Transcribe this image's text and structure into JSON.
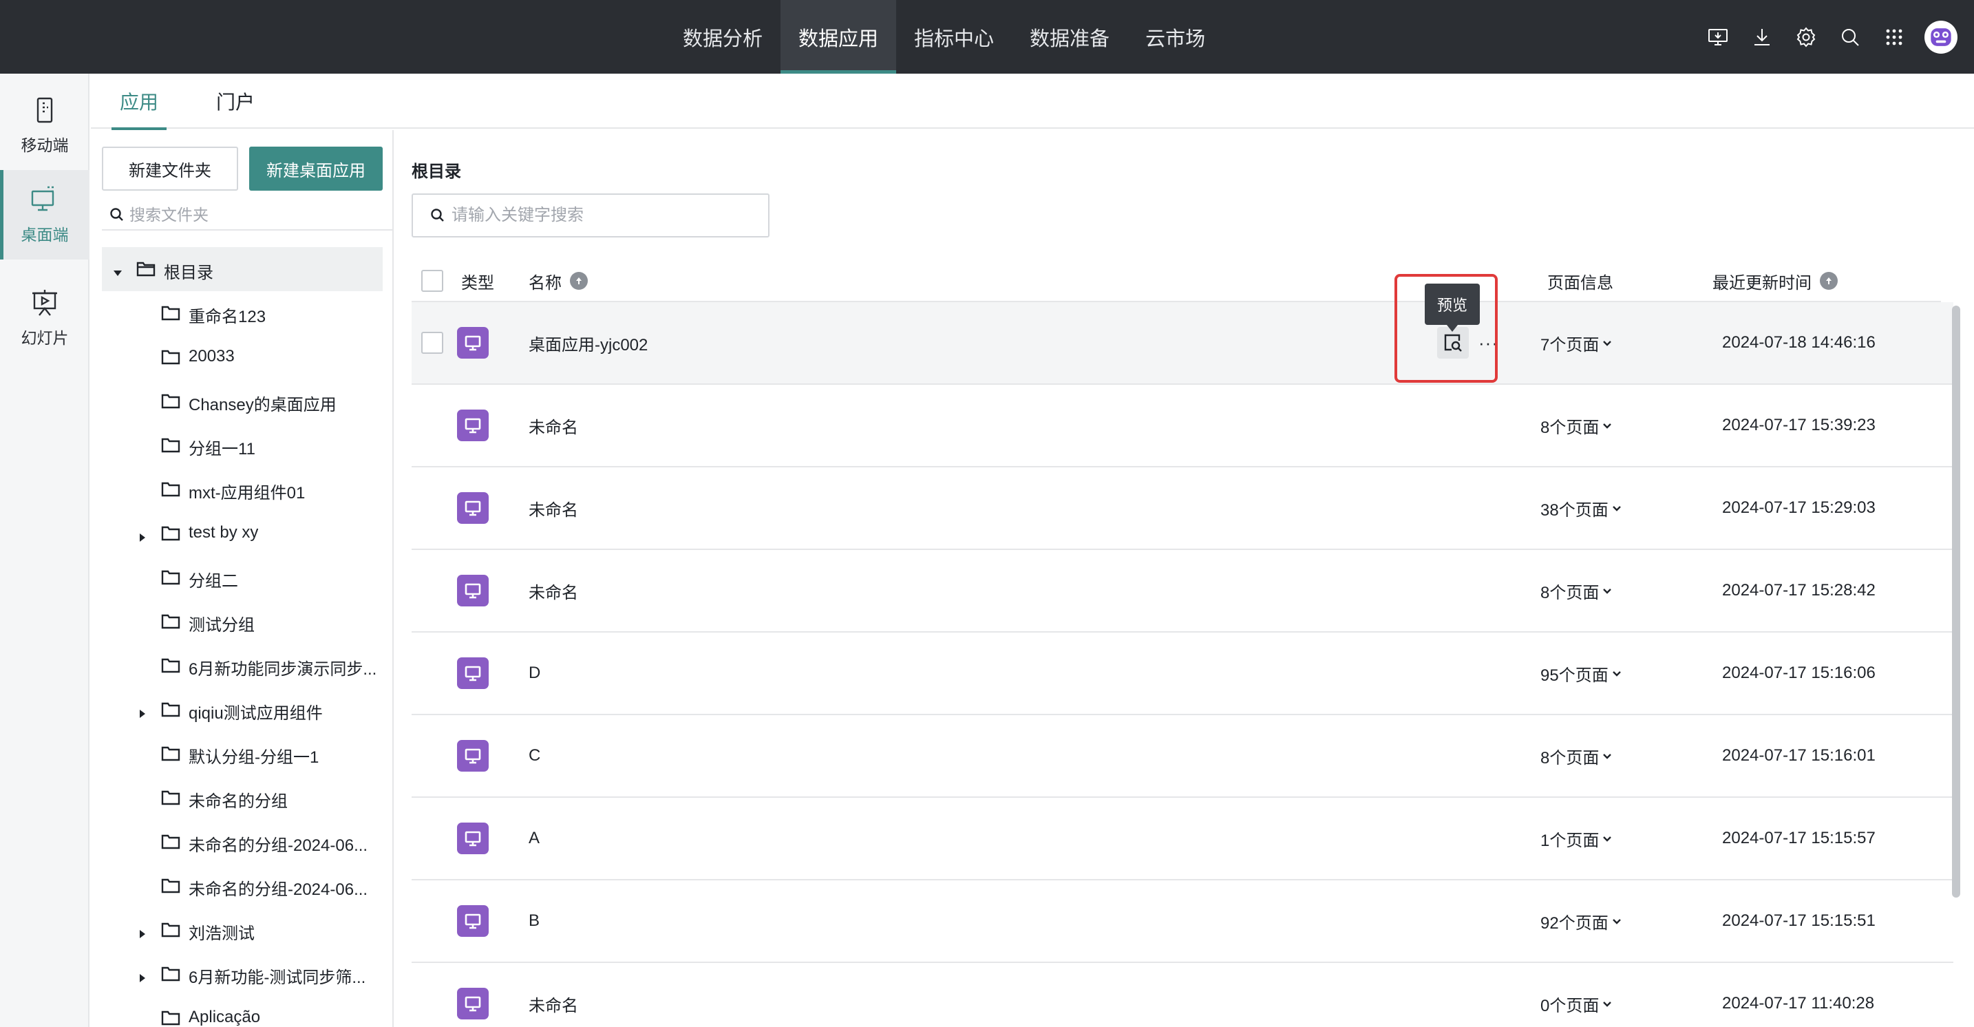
{
  "topnav": {
    "items": [
      {
        "label": "数据分析",
        "active": false
      },
      {
        "label": "数据应用",
        "active": true
      },
      {
        "label": "指标中心",
        "active": false
      },
      {
        "label": "数据准备",
        "active": false
      },
      {
        "label": "云市场",
        "active": false
      }
    ],
    "icons": [
      "desktop-download-icon",
      "download-icon",
      "gear-icon",
      "search-icon",
      "grid-apps-icon",
      "avatar"
    ],
    "accent_color": "#3d8b86",
    "bar_color": "#2b2e33"
  },
  "rail": {
    "items": [
      {
        "label": "移动端",
        "icon": "mobile-icon",
        "active": false
      },
      {
        "label": "桌面端",
        "icon": "desktop-icon",
        "active": true
      },
      {
        "label": "幻灯片",
        "icon": "slideshow-icon",
        "active": false
      }
    ]
  },
  "subtabs": [
    {
      "label": "应用",
      "active": true
    },
    {
      "label": "门户",
      "active": false
    }
  ],
  "folder_panel": {
    "new_folder_label": "新建文件夹",
    "new_app_label": "新建桌面应用",
    "search_placeholder": "搜索文件夹",
    "root_label": "根目录",
    "folders": [
      {
        "label": "重命名123",
        "expandable": false
      },
      {
        "label": "20033",
        "expandable": false
      },
      {
        "label": "Chansey的桌面应用",
        "expandable": false
      },
      {
        "label": "分组一11",
        "expandable": false
      },
      {
        "label": "mxt-应用组件01",
        "expandable": false
      },
      {
        "label": "test by xy",
        "expandable": true
      },
      {
        "label": "分组二",
        "expandable": false
      },
      {
        "label": "测试分组",
        "expandable": false
      },
      {
        "label": "6月新功能同步演示同步...",
        "expandable": false
      },
      {
        "label": "qiqiu测试应用组件",
        "expandable": true
      },
      {
        "label": "默认分组-分组一1",
        "expandable": false
      },
      {
        "label": "未命名的分组",
        "expandable": false
      },
      {
        "label": "未命名的分组-2024-06...",
        "expandable": false
      },
      {
        "label": "未命名的分组-2024-06...",
        "expandable": false
      },
      {
        "label": "刘浩测试",
        "expandable": true
      },
      {
        "label": "6月新功能-测试同步筛...",
        "expandable": true
      },
      {
        "label": "Aplicação",
        "expandable": false
      }
    ]
  },
  "main": {
    "breadcrumb": "根目录",
    "search_placeholder": "请输入关键字搜索",
    "columns": {
      "type": "类型",
      "name": "名称",
      "pages": "页面信息",
      "updated": "最近更新时间"
    },
    "tooltip": "预览",
    "rows": [
      {
        "name": "桌面应用-yjc002",
        "pages": "7个页面",
        "updated": "2024-07-18 14:46:16",
        "hover": true
      },
      {
        "name": "未命名",
        "pages": "8个页面",
        "updated": "2024-07-17 15:39:23",
        "hover": false
      },
      {
        "name": "未命名",
        "pages": "38个页面",
        "updated": "2024-07-17 15:29:03",
        "hover": false
      },
      {
        "name": "未命名",
        "pages": "8个页面",
        "updated": "2024-07-17 15:28:42",
        "hover": false
      },
      {
        "name": "D",
        "pages": "95个页面",
        "updated": "2024-07-17 15:16:06",
        "hover": false
      },
      {
        "name": "C",
        "pages": "8个页面",
        "updated": "2024-07-17 15:16:01",
        "hover": false
      },
      {
        "name": "A",
        "pages": "1个页面",
        "updated": "2024-07-17 15:15:57",
        "hover": false
      },
      {
        "name": "B",
        "pages": "92个页面",
        "updated": "2024-07-17 15:15:51",
        "hover": false
      },
      {
        "name": "未命名",
        "pages": "0个页面",
        "updated": "2024-07-17 11:40:28",
        "hover": false
      }
    ],
    "app_icon_color": "#8a5cc4",
    "highlight_color": "#e03a3a"
  }
}
